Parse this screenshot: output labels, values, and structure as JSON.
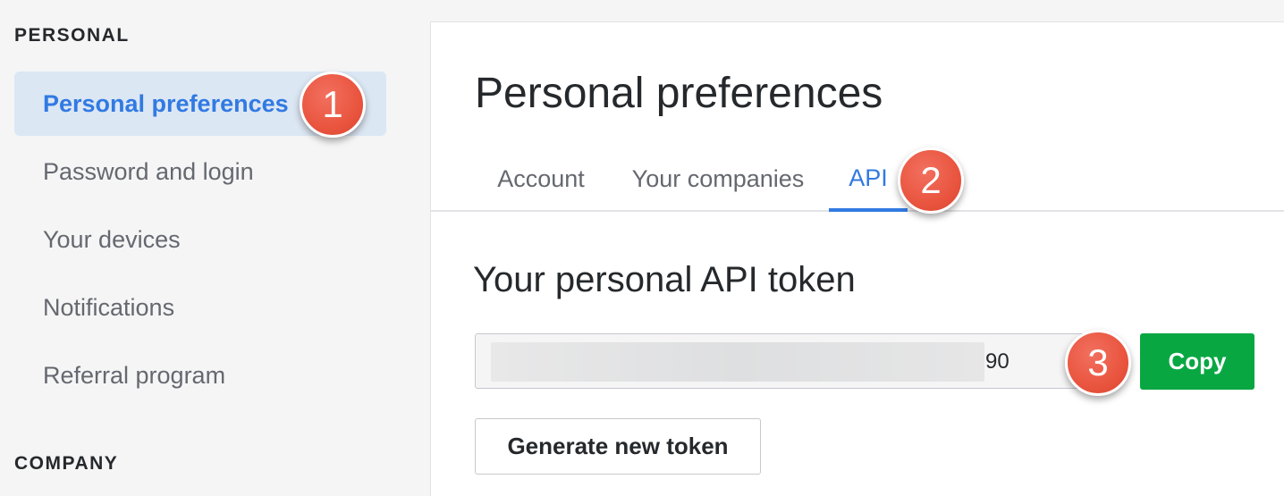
{
  "sidebar": {
    "section_personal": "PERSONAL",
    "section_company": "COMPANY",
    "items": [
      {
        "label": "Personal preferences",
        "active": true
      },
      {
        "label": "Password and login"
      },
      {
        "label": "Your devices"
      },
      {
        "label": "Notifications"
      },
      {
        "label": "Referral program"
      }
    ]
  },
  "main": {
    "title": "Personal preferences",
    "tabs": [
      {
        "label": "Account"
      },
      {
        "label": "Your companies"
      },
      {
        "label": "API",
        "active": true
      }
    ],
    "section_title": "Your personal API token",
    "token_visible_tail": "90",
    "copy_label": "Copy",
    "generate_label": "Generate new token"
  },
  "annotations": {
    "step1": "1",
    "step2": "2",
    "step3": "3"
  },
  "colors": {
    "accent": "#317ae2",
    "active_bg": "#dce7f4",
    "copy_button": "#08a742",
    "badge": "#e9553f"
  }
}
